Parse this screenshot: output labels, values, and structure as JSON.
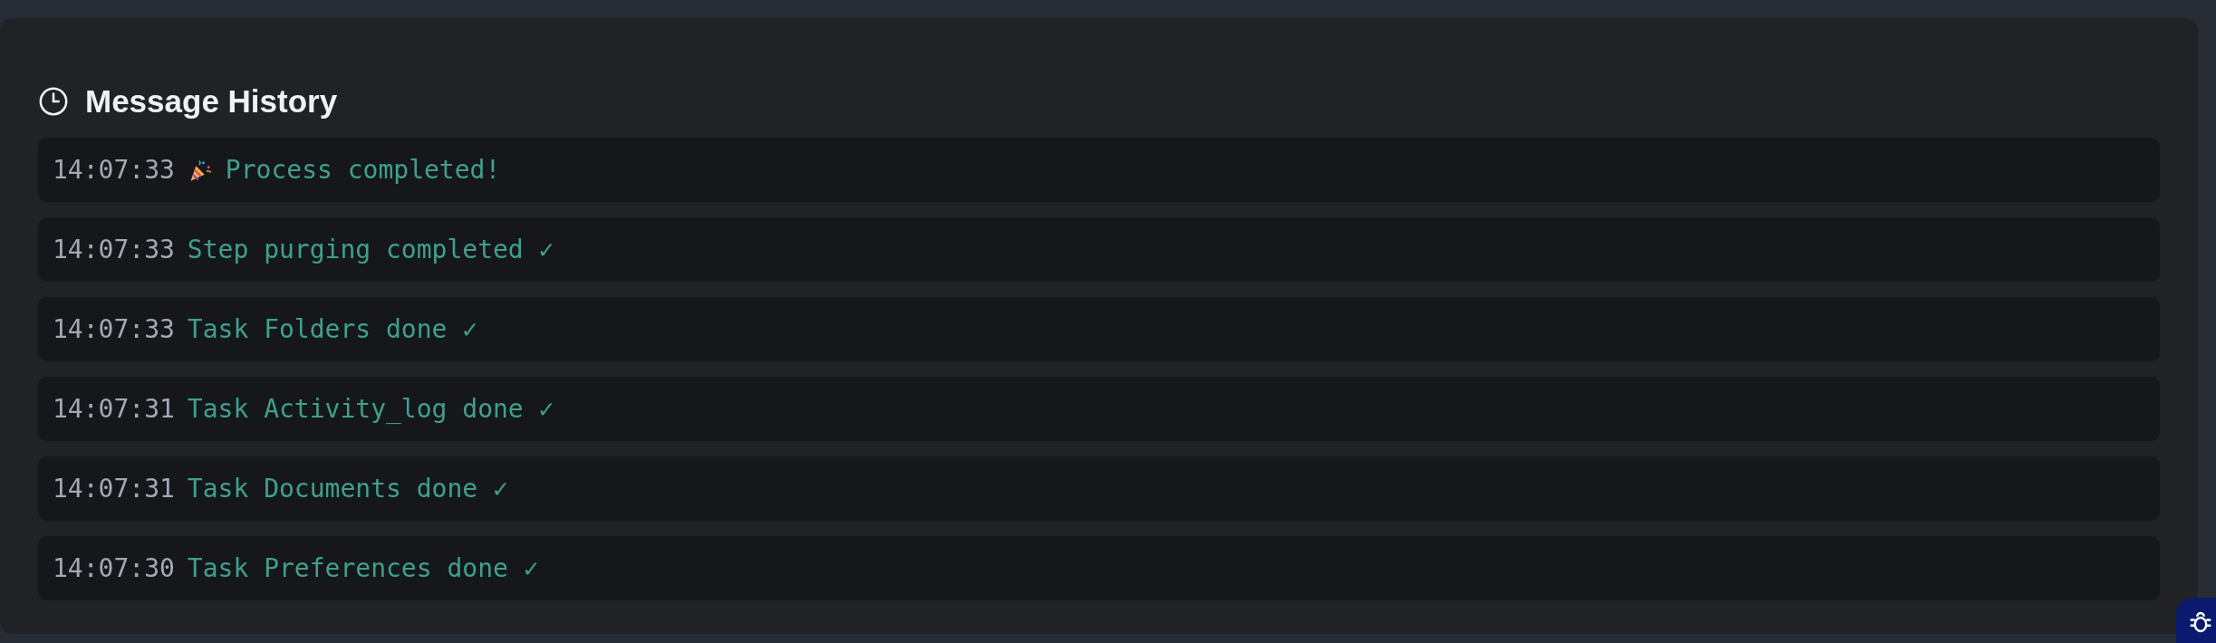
{
  "panel": {
    "title": "Message History"
  },
  "messages": [
    {
      "time": "14:07:33",
      "text": "Process completed!",
      "kind": "celebration"
    },
    {
      "time": "14:07:33",
      "text": "Step purging completed ✓",
      "kind": "plain"
    },
    {
      "time": "14:07:33",
      "text": "Task Folders done ✓",
      "kind": "plain"
    },
    {
      "time": "14:07:31",
      "text": "Task Activity_log done ✓",
      "kind": "plain"
    },
    {
      "time": "14:07:31",
      "text": "Task Documents done ✓",
      "kind": "plain"
    },
    {
      "time": "14:07:30",
      "text": "Task Preferences done ✓",
      "kind": "plain"
    }
  ]
}
